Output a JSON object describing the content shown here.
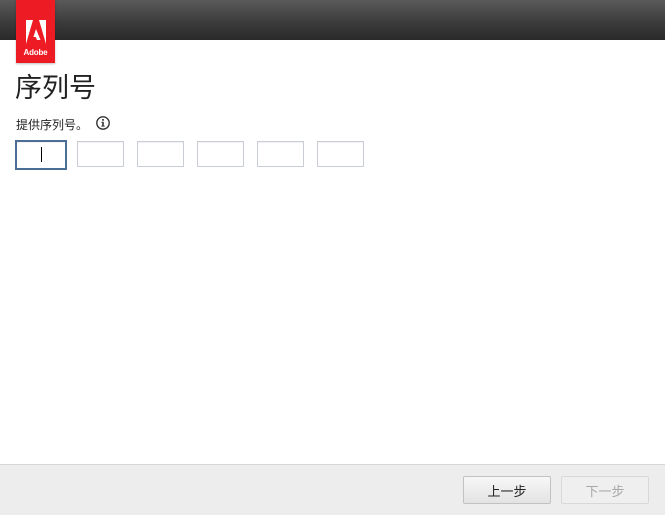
{
  "header": {
    "logo_text": "Adobe"
  },
  "main": {
    "title": "序列号",
    "subtitle": "提供序列号。",
    "info_icon": "info-icon",
    "serial_fields": [
      {
        "value": "",
        "active": true
      },
      {
        "value": "",
        "active": false
      },
      {
        "value": "",
        "active": false
      },
      {
        "value": "",
        "active": false
      },
      {
        "value": "",
        "active": false
      },
      {
        "value": "",
        "active": false
      }
    ]
  },
  "footer": {
    "back_label": "上一步",
    "next_label": "下一步",
    "next_enabled": false
  },
  "colors": {
    "adobe_red": "#ed1c24",
    "topbar": "#3c3c3c",
    "active_border": "#4a6e96",
    "footer_bg": "#ededed"
  }
}
